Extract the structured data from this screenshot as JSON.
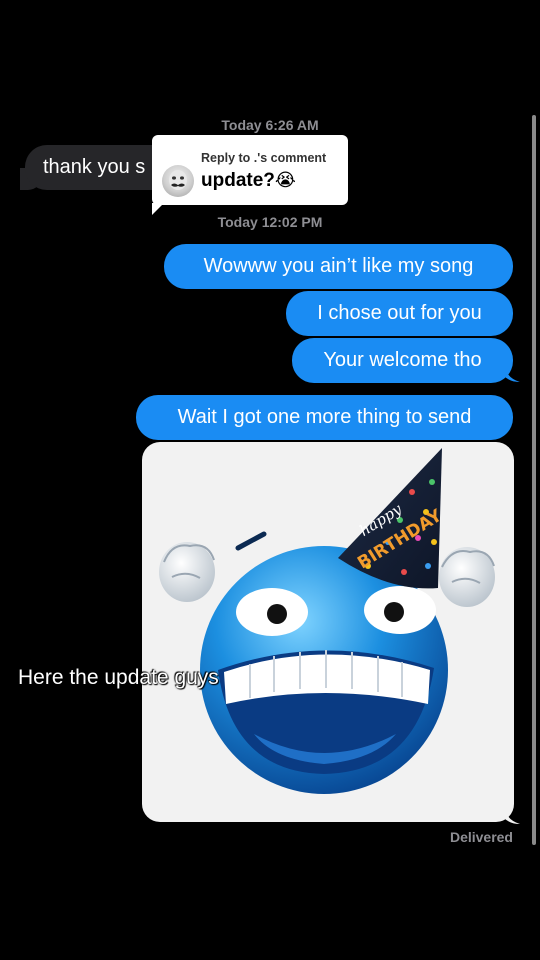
{
  "conversation": {
    "timestamp_1": "Today 6:26 AM",
    "timestamp_2": "Today 12:02 PM",
    "incoming": [
      {
        "text": "thank you s"
      }
    ],
    "outgoing": [
      {
        "text": "Wowww you ain’t like my song"
      },
      {
        "text": "I chose out for you"
      },
      {
        "text": "Your welcome tho"
      },
      {
        "text": "Wait I got one more thing to send"
      }
    ],
    "status": "Delivered"
  },
  "reply_card": {
    "label": "Reply to .'s comment",
    "text": "update?",
    "emoji": "😭"
  },
  "image": {
    "hat_text_1": "happy",
    "hat_text_2": "BIRTHDAY",
    "icon": "birthday-laughing-emoji-icon"
  },
  "overlay": {
    "caption": "Here the update guys"
  },
  "colors": {
    "background": "#000000",
    "incoming_bubble": "#262629",
    "outgoing_bubble": "#1a8cf3",
    "meta_text": "#8e8e93"
  }
}
